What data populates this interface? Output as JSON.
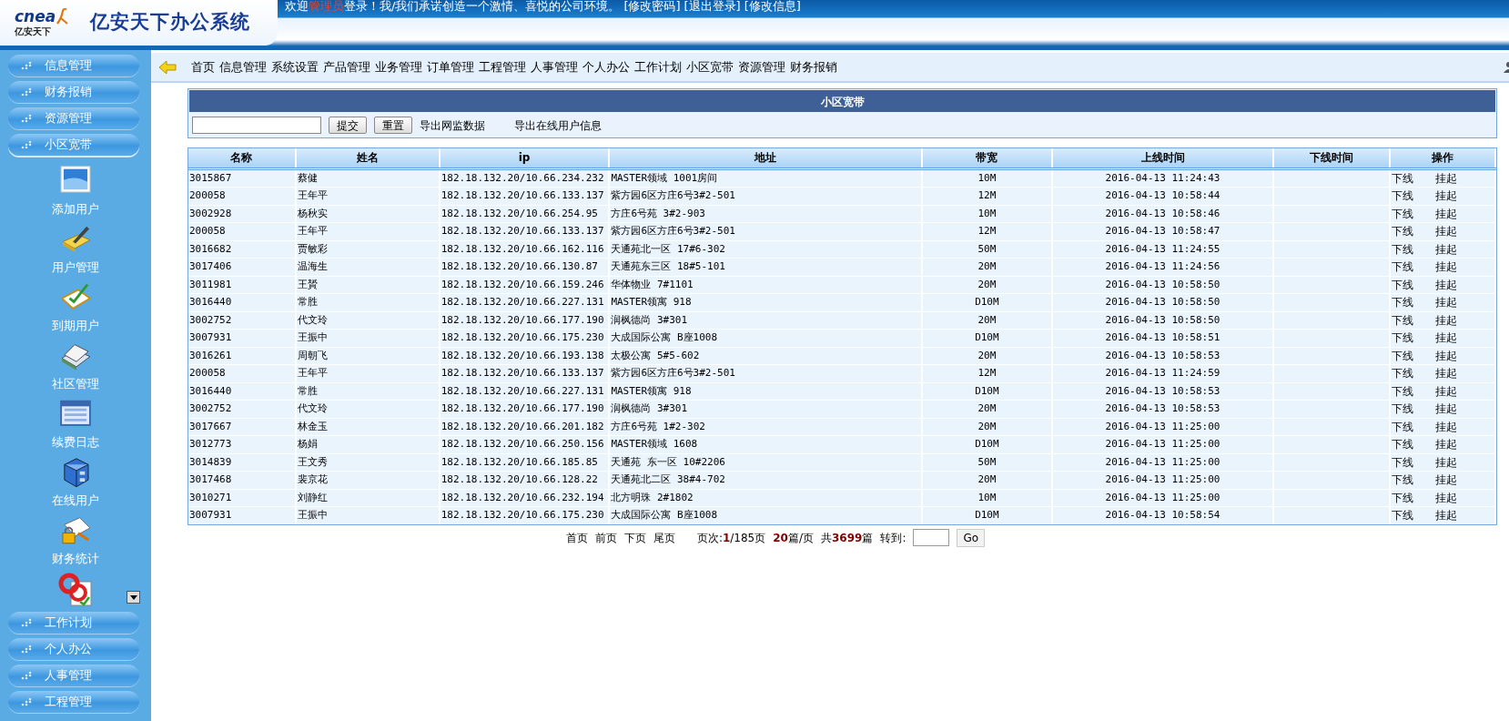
{
  "header": {
    "logo_text": "cnea",
    "logo_sub": "亿安天下",
    "title": "亿安天下办公系统",
    "welcome": {
      "prefix": "欢迎",
      "user": "管理员",
      "suffix": "登录！我/我们承诺创造一个激情、喜悦的公司环境。",
      "links": [
        "[修改密码]",
        "[退出登录]",
        "[修改信息]"
      ]
    }
  },
  "sidebar": {
    "groups": [
      {
        "label": "信息管理",
        "expanded": false
      },
      {
        "label": "财务报销",
        "expanded": false
      },
      {
        "label": "资源管理",
        "expanded": false
      },
      {
        "label": "小区宽带",
        "expanded": true,
        "children": [
          {
            "label": "添加用户"
          },
          {
            "label": "用户管理"
          },
          {
            "label": "到期用户"
          },
          {
            "label": "社区管理"
          },
          {
            "label": "续费日志"
          },
          {
            "label": "在线用户"
          },
          {
            "label": "财务统计"
          }
        ]
      },
      {
        "label": "工作计划",
        "expanded": false
      },
      {
        "label": "个人办公",
        "expanded": false
      },
      {
        "label": "人事管理",
        "expanded": false
      },
      {
        "label": "工程管理",
        "expanded": false
      }
    ]
  },
  "nav": {
    "items": [
      "首页",
      "信息管理",
      "系统设置",
      "产品管理",
      "业务管理",
      "订单管理",
      "工程管理",
      "人事管理",
      "个人办公",
      "工作计划",
      "小区宽带",
      "资源管理",
      "财务报销"
    ]
  },
  "panel": {
    "title": "小区宽带",
    "buttons": [
      "提交",
      "重置"
    ],
    "links": [
      "导出网监数据",
      "导出在线用户信息"
    ]
  },
  "table": {
    "columns": [
      "名称",
      "姓名",
      "ip",
      "地址",
      "带宽",
      "上线时间",
      "下线时间",
      "操作"
    ],
    "rows": [
      {
        "code": "3015867",
        "name": "蔡健",
        "ip": "182.18.132.20/10.66.234.232",
        "address": "MASTER领域 1001房间",
        "bandwidth": "10M",
        "online": "2016-04-13 11:24:43",
        "actions": [
          "下线",
          "挂起"
        ]
      },
      {
        "code": "200058",
        "name": "王年平",
        "ip": "182.18.132.20/10.66.133.137",
        "address": "紫方园6区方庄6号3#2-501",
        "bandwidth": "12M",
        "online": "2016-04-13 10:58:44",
        "actions": [
          "下线",
          "挂起"
        ]
      },
      {
        "code": "3002928",
        "name": "杨秋实",
        "ip": "182.18.132.20/10.66.254.95",
        "address": "方庄6号苑 3#2-903",
        "bandwidth": "10M",
        "online": "2016-04-13 10:58:46",
        "actions": [
          "下线",
          "挂起"
        ]
      },
      {
        "code": "200058",
        "name": "王年平",
        "ip": "182.18.132.20/10.66.133.137",
        "address": "紫方园6区方庄6号3#2-501",
        "bandwidth": "12M",
        "online": "2016-04-13 10:58:47",
        "actions": [
          "下线",
          "挂起"
        ]
      },
      {
        "code": "3016682",
        "name": "贾敏彩",
        "ip": "182.18.132.20/10.66.162.116",
        "address": "天通苑北一区 17#6-302",
        "bandwidth": "50M",
        "online": "2016-04-13 11:24:55",
        "actions": [
          "下线",
          "挂起"
        ]
      },
      {
        "code": "3017406",
        "name": "温海生",
        "ip": "182.18.132.20/10.66.130.87",
        "address": "天通苑东三区 18#5-101",
        "bandwidth": "20M",
        "online": "2016-04-13 11:24:56",
        "actions": [
          "下线",
          "挂起"
        ]
      },
      {
        "code": "3011981",
        "name": "王贇",
        "ip": "182.18.132.20/10.66.159.246",
        "address": "华体物业 7#1101",
        "bandwidth": "20M",
        "online": "2016-04-13 10:58:50",
        "actions": [
          "下线",
          "挂起"
        ]
      },
      {
        "code": "3016440",
        "name": "常胜",
        "ip": "182.18.132.20/10.66.227.131",
        "address": "MASTER领寓 918",
        "bandwidth": "D10M",
        "online": "2016-04-13 10:58:50",
        "actions": [
          "下线",
          "挂起"
        ]
      },
      {
        "code": "3002752",
        "name": "代文玲",
        "ip": "182.18.132.20/10.66.177.190",
        "address": "润枫德尚 3#301",
        "bandwidth": "20M",
        "online": "2016-04-13 10:58:50",
        "actions": [
          "下线",
          "挂起"
        ]
      },
      {
        "code": "3007931",
        "name": "王振中",
        "ip": "182.18.132.20/10.66.175.230",
        "address": "大成国际公寓 B座1008",
        "bandwidth": "D10M",
        "online": "2016-04-13 10:58:51",
        "actions": [
          "下线",
          "挂起"
        ]
      },
      {
        "code": "3016261",
        "name": "周朝飞",
        "ip": "182.18.132.20/10.66.193.138",
        "address": "太极公寓 5#5-602",
        "bandwidth": "20M",
        "online": "2016-04-13 10:58:53",
        "actions": [
          "下线",
          "挂起"
        ]
      },
      {
        "code": "200058",
        "name": "王年平",
        "ip": "182.18.132.20/10.66.133.137",
        "address": "紫方园6区方庄6号3#2-501",
        "bandwidth": "12M",
        "online": "2016-04-13 11:24:59",
        "actions": [
          "下线",
          "挂起"
        ]
      },
      {
        "code": "3016440",
        "name": "常胜",
        "ip": "182.18.132.20/10.66.227.131",
        "address": "MASTER领寓 918",
        "bandwidth": "D10M",
        "online": "2016-04-13 10:58:53",
        "actions": [
          "下线",
          "挂起"
        ]
      },
      {
        "code": "3002752",
        "name": "代文玲",
        "ip": "182.18.132.20/10.66.177.190",
        "address": "润枫德尚 3#301",
        "bandwidth": "20M",
        "online": "2016-04-13 10:58:53",
        "actions": [
          "下线",
          "挂起"
        ]
      },
      {
        "code": "3017667",
        "name": "林金玉",
        "ip": "182.18.132.20/10.66.201.182",
        "address": "方庄6号苑 1#2-302",
        "bandwidth": "20M",
        "online": "2016-04-13 11:25:00",
        "actions": [
          "下线",
          "挂起"
        ]
      },
      {
        "code": "3012773",
        "name": "杨娟",
        "ip": "182.18.132.20/10.66.250.156",
        "address": "MASTER领域 1608",
        "bandwidth": "D10M",
        "online": "2016-04-13 11:25:00",
        "actions": [
          "下线",
          "挂起"
        ]
      },
      {
        "code": "3014839",
        "name": "王文秀",
        "ip": "182.18.132.20/10.66.185.85",
        "address": "天通苑 东一区 10#2206",
        "bandwidth": "50M",
        "online": "2016-04-13 11:25:00",
        "actions": [
          "下线",
          "挂起"
        ]
      },
      {
        "code": "3017468",
        "name": "裴京花",
        "ip": "182.18.132.20/10.66.128.22",
        "address": "天通苑北二区 38#4-702",
        "bandwidth": "20M",
        "online": "2016-04-13 11:25:00",
        "actions": [
          "下线",
          "挂起"
        ]
      },
      {
        "code": "3010271",
        "name": "刘静红",
        "ip": "182.18.132.20/10.66.232.194",
        "address": "北方明珠 2#1802",
        "bandwidth": "10M",
        "online": "2016-04-13 11:25:00",
        "actions": [
          "下线",
          "挂起"
        ]
      },
      {
        "code": "3007931",
        "name": "王振中",
        "ip": "182.18.132.20/10.66.175.230",
        "address": "大成国际公寓 B座1008",
        "bandwidth": "D10M",
        "online": "2016-04-13 10:58:54",
        "actions": [
          "下线",
          "挂起"
        ]
      }
    ]
  },
  "pagination": {
    "links": [
      "首页",
      "前页",
      "下页",
      "尾页"
    ],
    "status": [
      "页次:**1**/185页",
      "**20**篇/页",
      "共**3699**篇"
    ],
    "goto_label": "转到:",
    "go_button": "Go"
  }
}
